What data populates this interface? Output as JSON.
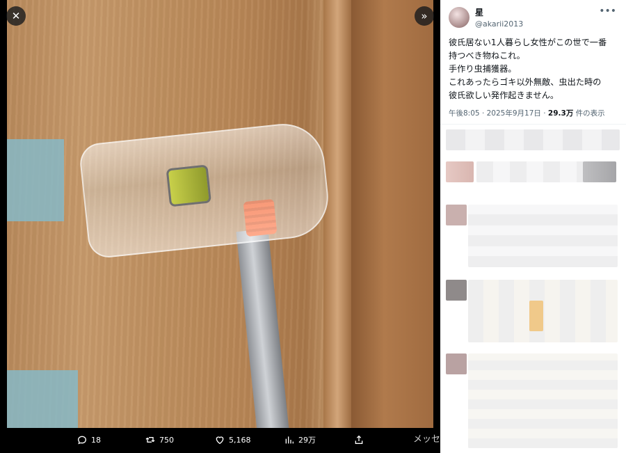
{
  "viewer": {
    "close_icon": "close-icon",
    "expand_icon": "expand-right-icon",
    "cut_text": "メッセ"
  },
  "actions": {
    "reply_count": "18",
    "retweet_count": "750",
    "like_count": "5,168",
    "view_count": "29万"
  },
  "tweet": {
    "author_name": "星",
    "author_handle": "@akarii2013",
    "lines": [
      "彼氏居ない1人暮らし女性がこの世で一番",
      "持つべき物ねこれ。",
      "手作り虫捕獲器。",
      "これあったらゴキ以外無敵、虫出た時の",
      "彼氏欲しい発作起きません。"
    ],
    "time": "午後8:05",
    "separator": "·",
    "date": "2025年9月17日",
    "views_number": "29.3万",
    "views_suffix": "件の表示"
  },
  "colors": {
    "accent": "#1d9bf0",
    "panel_bg": "#ffffff",
    "viewer_bg": "#000000"
  }
}
